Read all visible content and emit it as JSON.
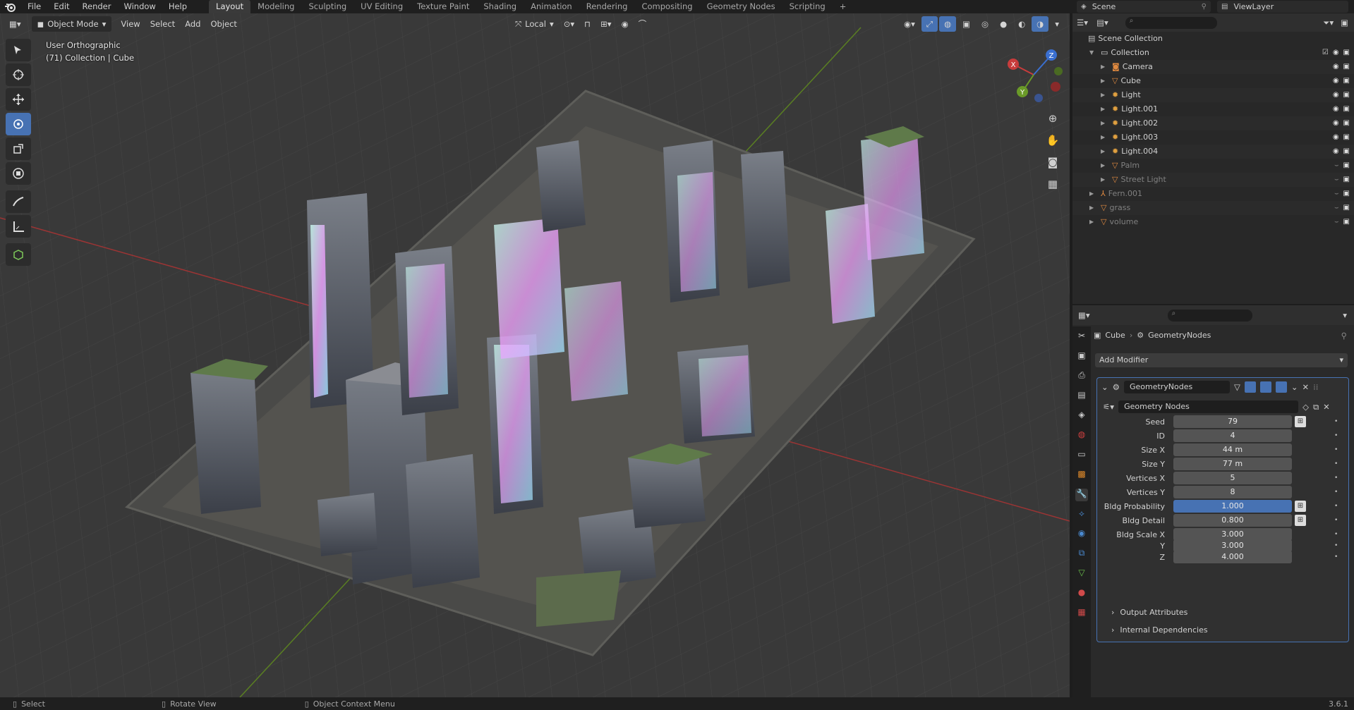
{
  "topbar": {
    "menus": [
      "File",
      "Edit",
      "Render",
      "Window",
      "Help"
    ],
    "workspaces": [
      "Layout",
      "Modeling",
      "Sculpting",
      "UV Editing",
      "Texture Paint",
      "Shading",
      "Animation",
      "Rendering",
      "Compositing",
      "Geometry Nodes",
      "Scripting"
    ],
    "active_workspace": "Layout",
    "add_tab": "+",
    "scene_label": "Scene",
    "viewlayer_label": "ViewLayer"
  },
  "viewport": {
    "mode": "Object Mode",
    "menus": [
      "View",
      "Select",
      "Add",
      "Object"
    ],
    "transform_orientation": "Local",
    "info_line1": "User Orthographic",
    "info_line2": "(71) Collection | Cube",
    "gizmo_axes": {
      "x": "X",
      "y": "Y",
      "z": "Z"
    }
  },
  "outliner": {
    "root": "Scene Collection",
    "items": [
      {
        "name": "Collection",
        "indent": 1
      },
      {
        "name": "Camera",
        "indent": 2
      },
      {
        "name": "Cube",
        "indent": 2
      },
      {
        "name": "Light",
        "indent": 2
      },
      {
        "name": "Light.001",
        "indent": 2
      },
      {
        "name": "Light.002",
        "indent": 2
      },
      {
        "name": "Light.003",
        "indent": 2
      },
      {
        "name": "Light.004",
        "indent": 2
      },
      {
        "name": "Palm",
        "indent": 2
      },
      {
        "name": "Street Light",
        "indent": 2
      },
      {
        "name": "Fern.001",
        "indent": 1
      },
      {
        "name": "grass",
        "indent": 1
      },
      {
        "name": "volume",
        "indent": 1
      }
    ]
  },
  "properties": {
    "breadcrumb_object": "Cube",
    "breadcrumb_modifier": "GeometryNodes",
    "add_modifier": "Add Modifier",
    "modifier_name": "GeometryNodes",
    "node_group": "Geometry Nodes",
    "fields": [
      {
        "label": "Seed",
        "value": "79"
      },
      {
        "label": "ID",
        "value": "4"
      },
      {
        "label": "Size X",
        "value": "44 m"
      },
      {
        "label": "Size Y",
        "value": "77 m"
      },
      {
        "label": "Vertices X",
        "value": "5"
      },
      {
        "label": "Vertices Y",
        "value": "8"
      },
      {
        "label": "Bldg Probability",
        "value": "1.000"
      },
      {
        "label": "Bldg Detail",
        "value": "0.800"
      },
      {
        "label": "Bldg Scale X",
        "value": "3.000"
      },
      {
        "label": "Y",
        "value": "3.000"
      },
      {
        "label": "Z",
        "value": "4.000"
      }
    ],
    "output_attributes": "Output Attributes",
    "internal_dependencies": "Internal Dependencies"
  },
  "statusbar": {
    "select": "Select",
    "rotate": "Rotate View",
    "context": "Object Context Menu",
    "version": "3.6.1"
  },
  "colors": {
    "accent": "#4772b3",
    "x_axis": "#c83c3c",
    "y_axis": "#6a9a28",
    "z_axis": "#3a6fd0"
  }
}
